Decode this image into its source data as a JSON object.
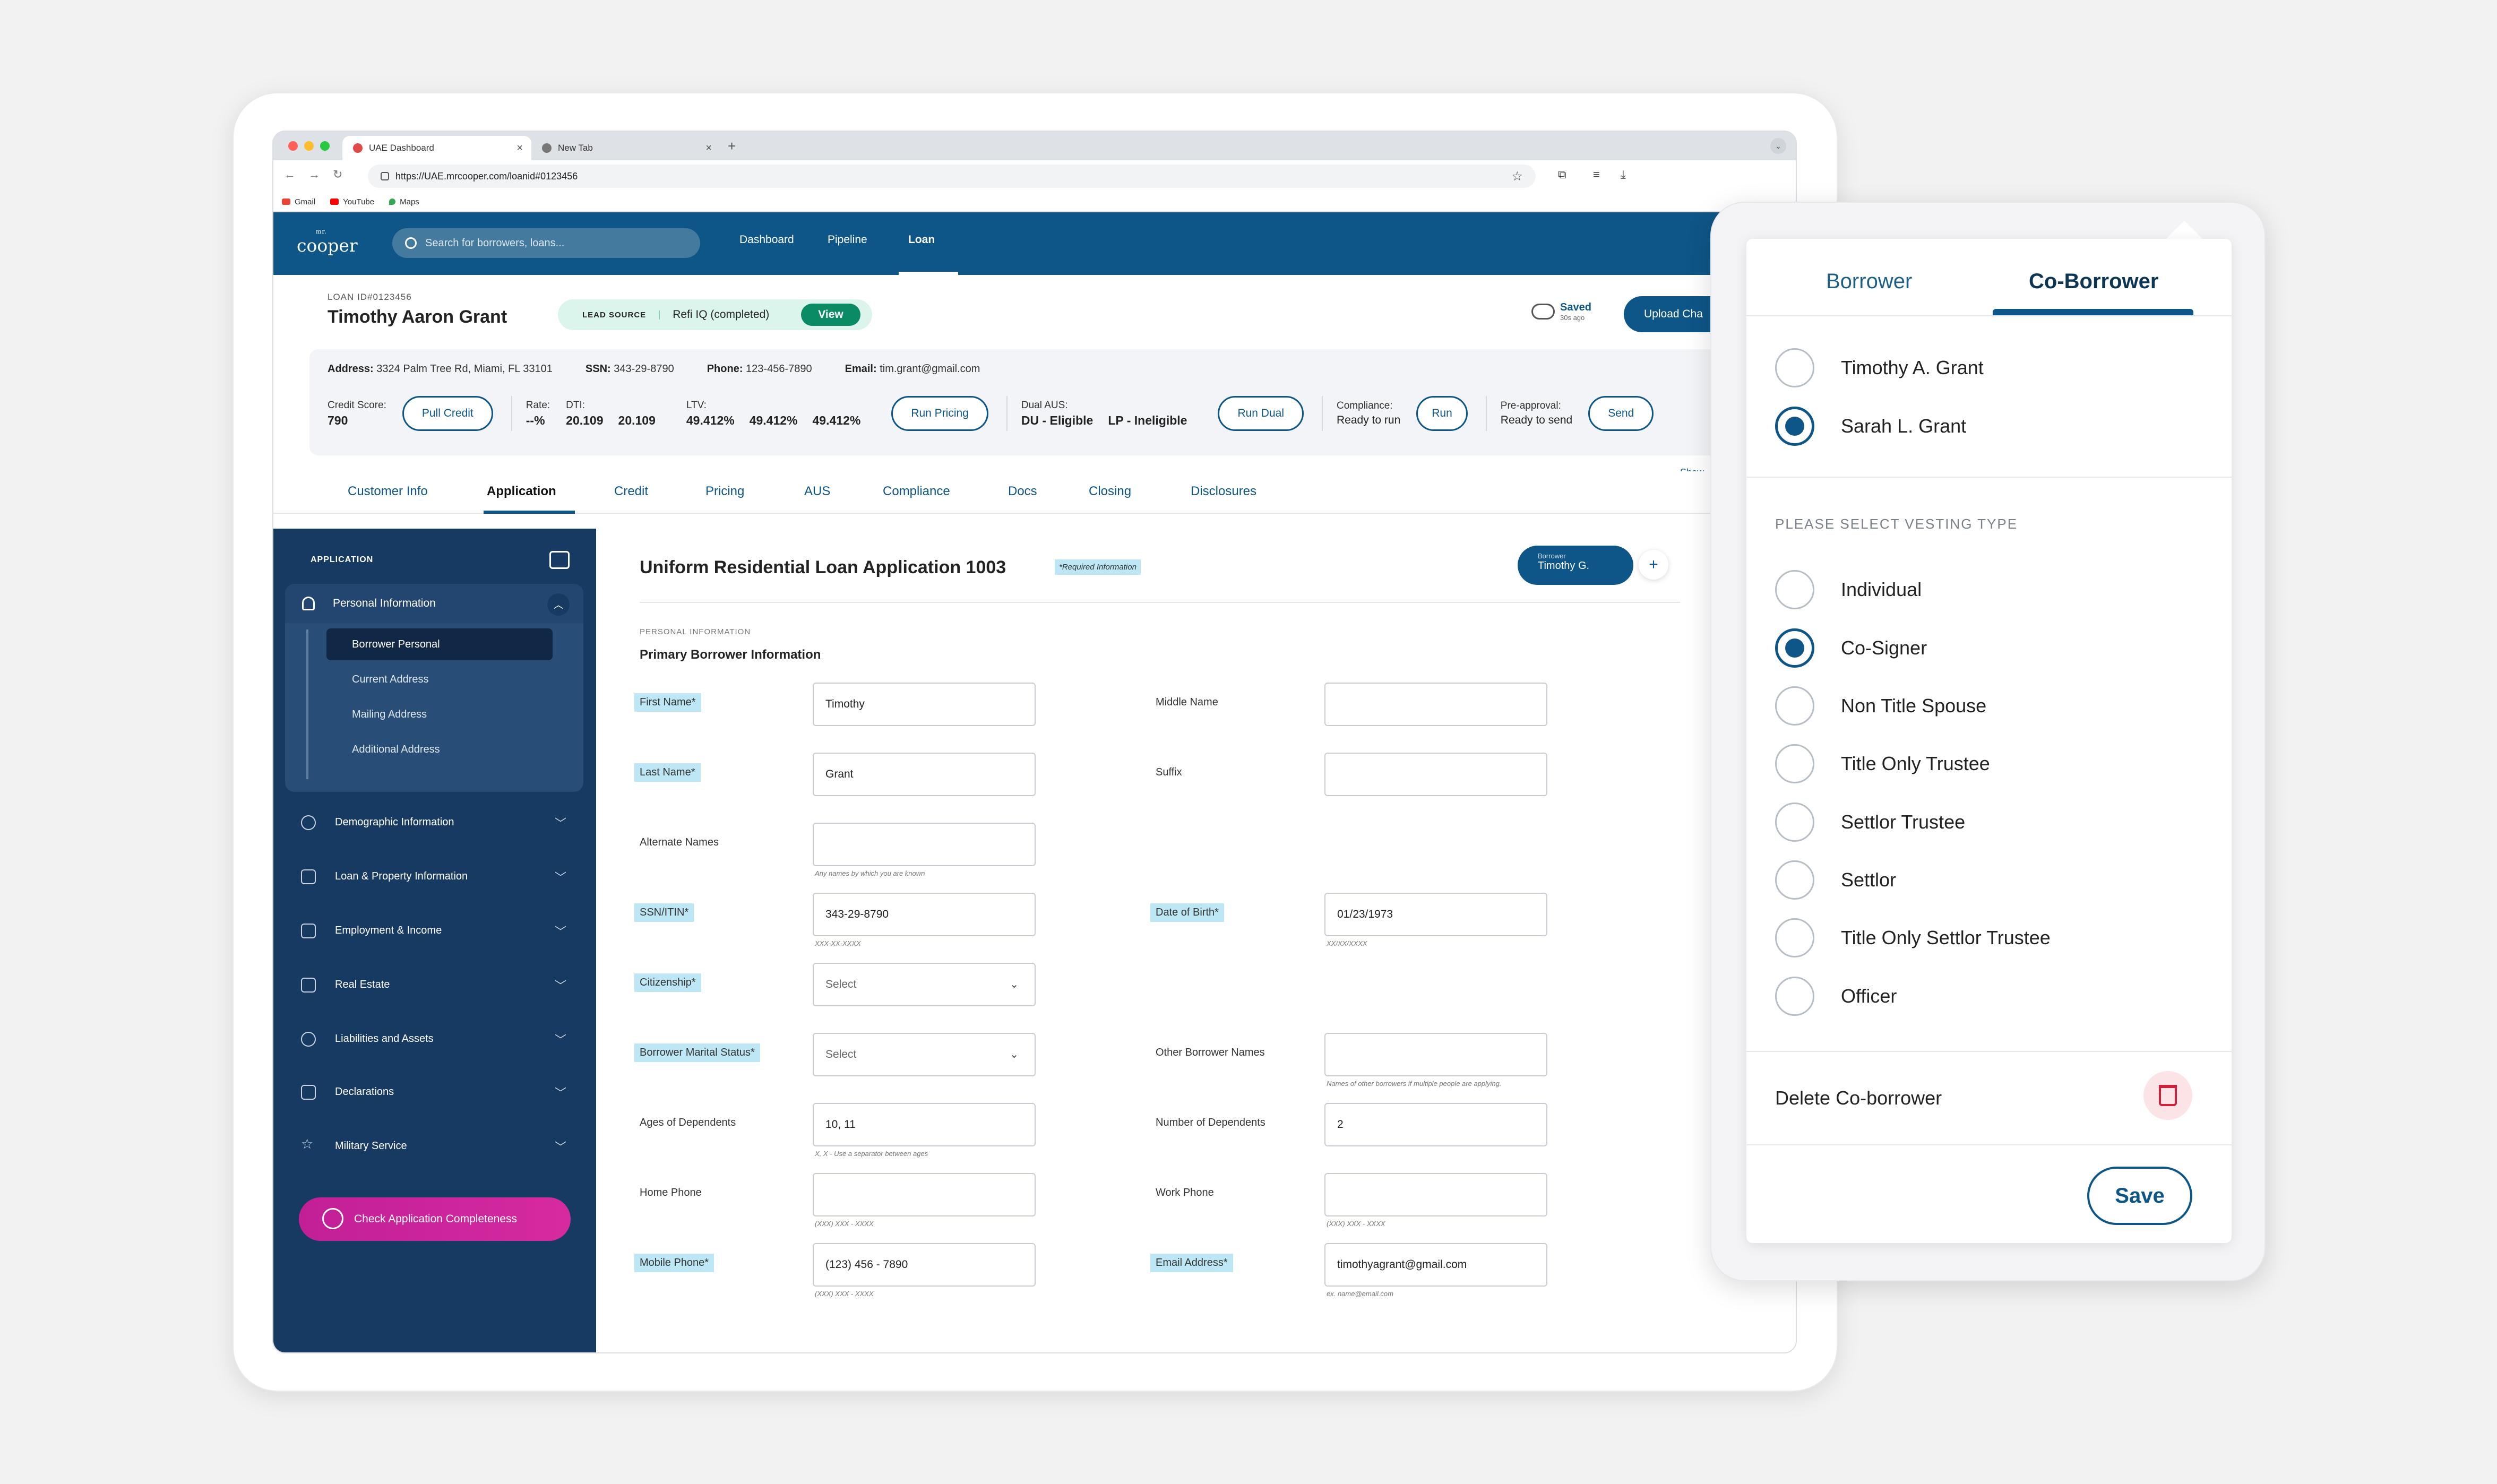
{
  "browser": {
    "tabs": [
      {
        "label": "UAE Dashboard",
        "active": true
      },
      {
        "label": "New Tab",
        "active": false
      }
    ],
    "url": "https://UAE.mrcooper.com/loanid#0123456",
    "bookmarks": [
      "Gmail",
      "YouTube",
      "Maps"
    ]
  },
  "app": {
    "logo_top": "mr.",
    "logo": "cooper",
    "search_placeholder": "Search for borrowers, loans...",
    "nav": [
      "Dashboard",
      "Pipeline",
      "Loan"
    ],
    "nav_active": "Loan"
  },
  "loan": {
    "id_label": "LOAN ID#0123456",
    "borrower_name": "Timothy Aaron Grant",
    "lead_source_label": "LEAD SOURCE",
    "lead_source_value": "Refi IQ (completed)",
    "view_label": "View",
    "saved_label": "Saved",
    "saved_time": "30s ago",
    "upload_label": "Upload Cha",
    "address_label": "Address:",
    "address": "3324 Palm Tree Rd, Miami, FL 33101",
    "ssn_label": "SSN:",
    "ssn": "343-29-8790",
    "phone_label": "Phone:",
    "phone": "123-456-7890",
    "email_label": "Email:",
    "email": "tim.grant@gmail.com",
    "credit_label": "Credit Score:",
    "credit_score": "790",
    "pull_credit": "Pull Credit",
    "rate_label": "Rate:",
    "rate": "--%",
    "dti_label": "DTI:",
    "dti": [
      "20.109",
      "20.109"
    ],
    "ltv_label": "LTV:",
    "ltv": [
      "49.412%",
      "49.412%",
      "49.412%"
    ],
    "run_pricing": "Run Pricing",
    "dual_aus_label": "Dual AUS:",
    "du": "DU - Eligible",
    "lp": "LP - Ineligible",
    "run_dual": "Run Dual",
    "compliance_label": "Compliance:",
    "compliance": "Ready to run",
    "run": "Run",
    "preapproval_label": "Pre-approval:",
    "preapproval": "Ready to send",
    "send": "Send",
    "show_more": "Show"
  },
  "app_tabs": [
    "Customer Info",
    "Application",
    "Credit",
    "Pricing",
    "AUS",
    "Compliance",
    "Docs",
    "Closing",
    "Disclosures"
  ],
  "sidebar": {
    "heading": "APPLICATION",
    "group": "Personal Information",
    "sub_items": [
      "Borrower Personal",
      "Current Address",
      "Mailing Address",
      "Additional Address"
    ],
    "items": [
      "Demographic Information",
      "Loan & Property Information",
      "Employment & Income",
      "Real Estate",
      "Liabilities and Assets",
      "Declarations",
      "Military Service"
    ],
    "check_button": "Check Application Completeness"
  },
  "form": {
    "title": "Uniform Residential Loan Application 1003",
    "required_tag": "*Required Information",
    "borrower_pill_small": "Borrower",
    "borrower_pill_name": "Timothy G.",
    "section_label": "PERSONAL INFORMATION",
    "subsection": "Primary Borrower Information",
    "fields": {
      "first_name": {
        "label": "First Name*",
        "value": "Timothy"
      },
      "middle_name": {
        "label": "Middle Name",
        "value": ""
      },
      "last_name": {
        "label": "Last Name*",
        "value": "Grant"
      },
      "suffix": {
        "label": "Suffix",
        "value": ""
      },
      "alternate_names": {
        "label": "Alternate Names",
        "value": "",
        "hint": "Any names by which you are known"
      },
      "ssn": {
        "label": "SSN/ITIN*",
        "value": "343-29-8790",
        "hint": "XXX-XX-XXXX"
      },
      "dob": {
        "label": "Date of Birth*",
        "value": "01/23/1973",
        "hint": "XX/XX/XXXX"
      },
      "citizenship": {
        "label": "Citizenship*",
        "value": "Select"
      },
      "marital_status": {
        "label": "Borrower Marital Status*",
        "value": "Select"
      },
      "other_names": {
        "label": "Other Borrower Names",
        "value": "",
        "hint": "Names of other borrowers if multiple people are applying."
      },
      "ages_dependents": {
        "label": "Ages of Dependents",
        "value": "10, 11",
        "hint": "X, X - Use a separator between ages"
      },
      "num_dependents": {
        "label": "Number of Dependents",
        "value": "2"
      },
      "home_phone": {
        "label": "Home Phone",
        "value": "",
        "hint": "(XXX) XXX - XXXX"
      },
      "work_phone": {
        "label": "Work Phone",
        "value": "",
        "hint": "(XXX) XXX - XXXX"
      },
      "mobile_phone": {
        "label": "Mobile Phone*",
        "value": "(123) 456 - 7890",
        "hint": "(XXX) XXX - XXXX"
      },
      "email": {
        "label": "Email Address*",
        "value": "timothyagrant@gmail.com",
        "hint": "ex. name@email.com"
      }
    }
  },
  "popover": {
    "tabs": [
      "Borrower",
      "Co-Borrower"
    ],
    "active_tab": "Co-Borrower",
    "people": [
      {
        "name": "Timothy A. Grant",
        "selected": false
      },
      {
        "name": "Sarah L. Grant",
        "selected": true
      }
    ],
    "vesting_heading": "PLEASE SELECT VESTING TYPE",
    "vesting": [
      {
        "label": "Individual",
        "selected": false
      },
      {
        "label": "Co-Signer",
        "selected": true
      },
      {
        "label": "Non Title Spouse",
        "selected": false
      },
      {
        "label": "Title Only Trustee",
        "selected": false
      },
      {
        "label": "Settlor Trustee",
        "selected": false
      },
      {
        "label": "Settlor",
        "selected": false
      },
      {
        "label": "Title Only Settlor Trustee",
        "selected": false
      },
      {
        "label": "Officer",
        "selected": false
      }
    ],
    "delete_label": "Delete Co-borrower",
    "save_label": "Save"
  },
  "colors": {
    "brand": "#0e5687",
    "sidebar": "#173a63",
    "accent_pink": "#c21f97",
    "required_highlight": "#bde7f4"
  }
}
